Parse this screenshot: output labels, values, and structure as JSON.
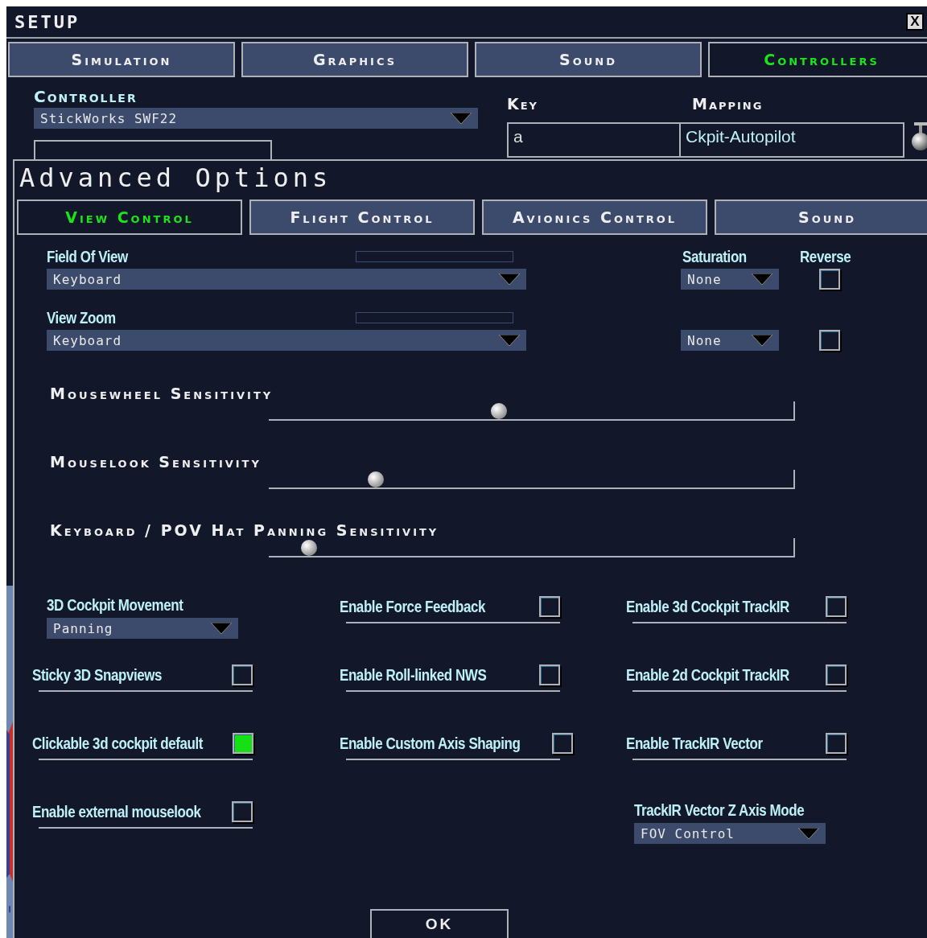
{
  "window": {
    "title": "SETUP",
    "close_label": "X"
  },
  "tabs": [
    {
      "label": "Simulation",
      "selected": false
    },
    {
      "label": "Graphics",
      "selected": false
    },
    {
      "label": "Sound",
      "selected": false
    },
    {
      "label": "Controllers",
      "selected": true
    }
  ],
  "controller": {
    "label": "Controller",
    "value": "StickWorks SWF22"
  },
  "mapping_table": {
    "columns": [
      "Key",
      "Mapping"
    ],
    "rows": [
      {
        "key": "a",
        "mapping": "Ckpit-Autopilot"
      }
    ]
  },
  "advanced": {
    "title": "Advanced Options",
    "tabs": [
      {
        "label": "View Control",
        "selected": true
      },
      {
        "label": "Flight Control",
        "selected": false
      },
      {
        "label": "Avionics Control",
        "selected": false
      },
      {
        "label": "Sound",
        "selected": false
      }
    ],
    "saturation_header": "Saturation",
    "reverse_header": "Reverse",
    "axes": [
      {
        "label": "Field Of View",
        "value": "Keyboard",
        "saturation": "None",
        "reverse": false
      },
      {
        "label": "View Zoom",
        "value": "Keyboard",
        "saturation": "None",
        "reverse": false
      }
    ],
    "sliders": [
      {
        "label": "Mousewheel Sensitivity",
        "level": 0.44
      },
      {
        "label": "Mouselook Sensitivity",
        "level": 0.205
      },
      {
        "label": "Keyboard / POV Hat Panning Sensitivity",
        "level": 0.078
      }
    ],
    "option_columns": [
      [
        {
          "kind": "dropdown",
          "label": "3D Cockpit Movement",
          "value": "Panning"
        },
        {
          "kind": "checkbox",
          "label": "Sticky 3D Snapviews",
          "checked": false
        },
        {
          "kind": "checkbox",
          "label": "Clickable 3d cockpit default",
          "checked": true
        },
        {
          "kind": "checkbox",
          "label": "Enable external mouselook",
          "checked": false
        }
      ],
      [
        {
          "kind": "checkbox",
          "label": "Enable Force Feedback",
          "checked": false
        },
        {
          "kind": "checkbox",
          "label": "Enable Roll-linked NWS",
          "checked": false
        },
        {
          "kind": "checkbox",
          "label": "Enable Custom Axis Shaping",
          "checked": false
        }
      ],
      [
        {
          "kind": "checkbox",
          "label": "Enable 3d Cockpit TrackIR",
          "checked": false
        },
        {
          "kind": "checkbox",
          "label": "Enable 2d Cockpit TrackIR",
          "checked": false
        },
        {
          "kind": "checkbox",
          "label": "Enable TrackIR Vector",
          "checked": false
        },
        {
          "kind": "dropdown",
          "label": "TrackIR Vector Z Axis Mode",
          "value": "FOV Control"
        }
      ]
    ],
    "ok_button": "OK"
  }
}
